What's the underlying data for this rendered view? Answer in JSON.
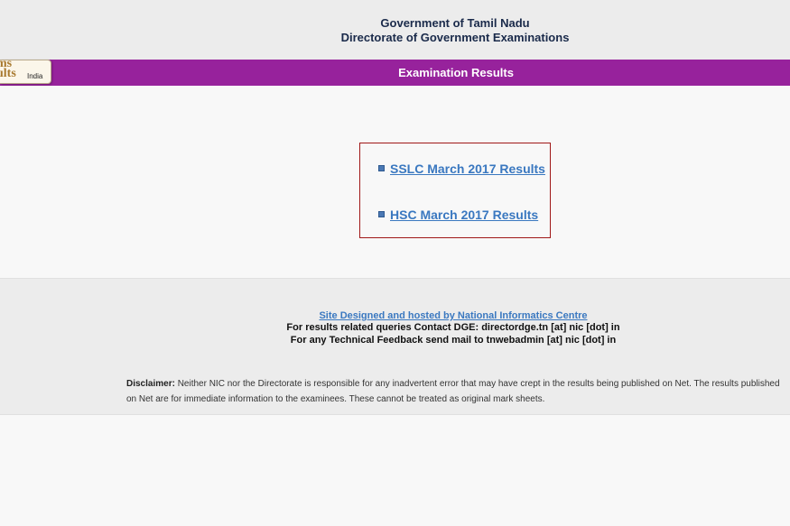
{
  "header": {
    "line1": "Government of Tamil Nadu",
    "line2": "Directorate of Government Examinations"
  },
  "logo": {
    "text_top": "ms",
    "text_bottom": "ults",
    "region": "India"
  },
  "banner": {
    "title": "Examination Results"
  },
  "results": {
    "items": [
      {
        "label": "SSLC March 2017 Results"
      },
      {
        "label": "HSC March 2017 Results"
      }
    ]
  },
  "footer": {
    "credit": "Site Designed and hosted by National Informatics Centre",
    "contact_queries": "For results related queries Contact DGE:  directordge.tn [at] nic [dot] in",
    "contact_feedback": "For any Technical Feedback send mail to tnwebadmin [at] nic [dot] in",
    "disclaimer_label": "Disclaimer:",
    "disclaimer_text": " Neither NIC nor the Directorate is responsible for any inadvertent error that may have crept in the results being published on Net. The results published on Net are for immediate information to the examinees. These cannot be treated as original mark sheets."
  },
  "colors": {
    "banner": "#97229c",
    "link": "#3a78c0",
    "box_border": "#a01818"
  }
}
